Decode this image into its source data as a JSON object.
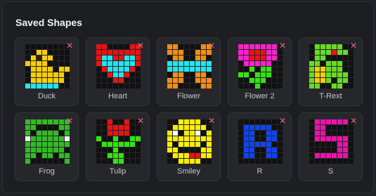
{
  "panel": {
    "title": "Saved Shapes",
    "close_glyph": "✕",
    "colors": {
      "off": "#111111"
    },
    "shapes": [
      {
        "label": "Duck",
        "palette": {
          "y": "#ffcc00",
          "c": "#22e5ee",
          "k": "#222222"
        },
        "pixels": [
          "........",
          "..yy....",
          ".ykyy...",
          "yyyy....",
          ".yyyy.yy",
          ".yyyyyy.",
          ".yyyyyy.",
          "cccccc.."
        ]
      },
      {
        "label": "Heart",
        "palette": {
          "r": "#ee1111",
          "c": "#22e5ee"
        },
        "pixels": [
          "rr....rr",
          "rrrrrrrr",
          "rccrrccr",
          "rccccccr",
          ".rccccr.",
          "..rccr..",
          "...rr...",
          "........"
        ]
      },
      {
        "label": "Flower",
        "palette": {
          "o": "#ff8c11",
          "c": "#22e5ee"
        },
        "pixels": [
          "oo....oo",
          "ooo..ooo",
          ".oo..oo.",
          "cccccccc",
          "cccccccc",
          ".oo..oo.",
          "ooo..ooo",
          "oo....oo"
        ]
      },
      {
        "label": "Flower 2",
        "palette": {
          "m": "#ff22cc",
          "r": "#ee1111",
          "g": "#33e411"
        },
        "pixels": [
          "mmmmmmm.",
          "mmrrrmm.",
          "mmrrrmm.",
          ".mmmmm..",
          "..g.gg..",
          "gg.ggg..",
          "..ggg...",
          "...g...."
        ]
      },
      {
        "label": "T-Rext",
        "palette": {
          "g": "#66dd22",
          "y": "#ffcc00",
          "r": "#ee1111"
        },
        "pixels": [
          ".ggggg..",
          ".gggrgg.",
          ".gg.....",
          "gg.ggg..",
          "gyyggg..",
          "gyygggg.",
          "gyyg.gg.",
          "gg..gg.."
        ]
      },
      {
        "label": "Frog",
        "palette": {
          "g": "#33bb22",
          "w": "#ffffff",
          "k": "#111111"
        },
        "pixels": [
          "gggggggg",
          "gg....gg",
          "gkggggkg",
          "wggggggw",
          "gggggggg",
          "ggggggg.",
          "gg.gg.gg",
          "g......g"
        ]
      },
      {
        "label": "Tulip",
        "palette": {
          "r": "#ee1111",
          "g": "#33e411"
        },
        "pixels": [
          "..r..r..",
          "..rrrr..",
          "..rrrr..",
          "g..g..gg",
          ".gggggg.",
          "...g....",
          "..ggg...",
          "...gg..."
        ]
      },
      {
        "label": "Smiley",
        "palette": {
          "y": "#ffee00",
          "w": "#ffffff",
          "k": "#111111",
          "r": "#ee1111"
        },
        "pixels": [
          "..yyyy..",
          ".yyyyyy.",
          "ywkyywky",
          "yyyyyyyy",
          "ykyyyyky",
          "yykkkkyy",
          ".yyyrryy",
          "..yyyy.."
        ]
      },
      {
        "label": "R",
        "palette": {
          "b": "#1144ee"
        },
        "pixels": [
          "........",
          ".bbbbb..",
          ".bb..bb.",
          ".bb..bb.",
          ".bbbbb..",
          ".bb..bb.",
          ".bb..bb.",
          "........"
        ]
      },
      {
        "label": "S",
        "palette": {
          "m": "#ee11aa"
        },
        "pixels": [
          ".mmmmmm.",
          ".mm.....",
          ".mm.....",
          ".mmmmmm.",
          ".....mm.",
          ".....mm.",
          ".mmmmmm.",
          "........"
        ]
      }
    ]
  }
}
